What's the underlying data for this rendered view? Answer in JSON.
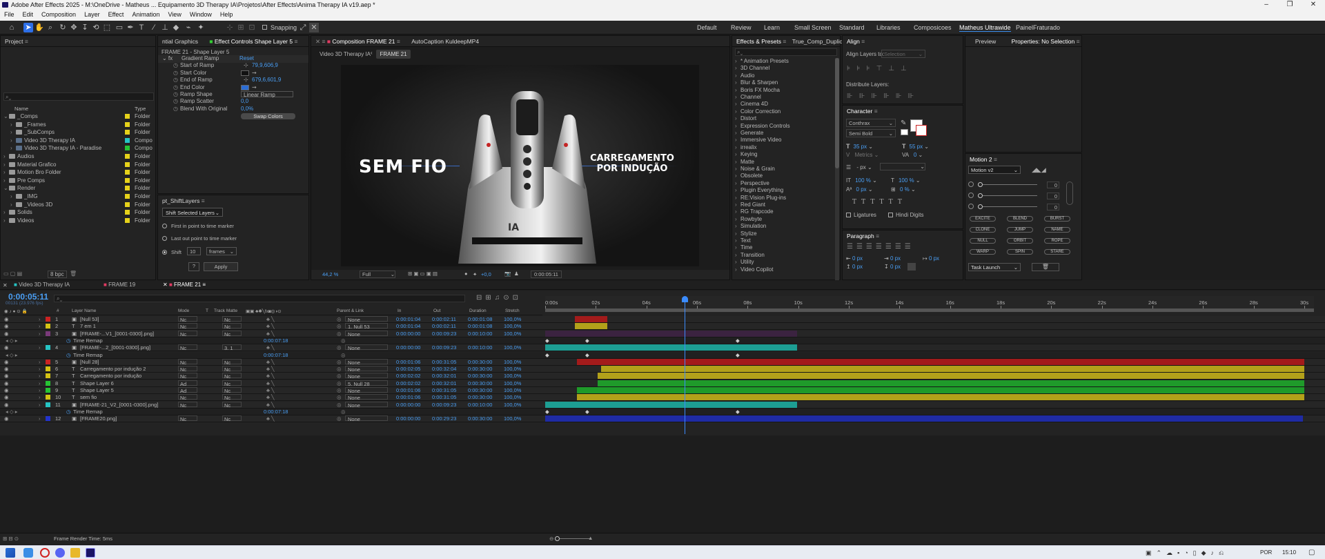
{
  "window": {
    "title": "Adobe After Effects 2025 - M:\\OneDrive - Matheus ... Equipamento 3D Therapy IA\\Projetos\\After Effects\\Anima Therapy IA v19.aep *"
  },
  "menu": [
    "File",
    "Edit",
    "Composition",
    "Layer",
    "Effect",
    "Animation",
    "View",
    "Window",
    "Help"
  ],
  "toolbar": {
    "snapping": "Snapping",
    "workspaces": [
      "Default",
      "Review",
      "Learn",
      "Small Screen",
      "Standard",
      "Libraries",
      "Composicoes",
      "Matheus Ultrawide",
      "PainelFraturado"
    ]
  },
  "project": {
    "title": "Project",
    "search": "",
    "col_name": "Name",
    "col_type": "Type",
    "bpc": "8 bpc",
    "items": [
      {
        "name": "_Comps",
        "type": "Folder",
        "color": "#e6d21a",
        "level": 0,
        "open": true
      },
      {
        "name": "_Frames",
        "type": "Folder",
        "color": "#e6d21a",
        "level": 1
      },
      {
        "name": "_SubComps",
        "type": "Folder",
        "color": "#e6d21a",
        "level": 1
      },
      {
        "name": "Video 3D Therapy IA",
        "type": "Compo",
        "color": "#26c4c4",
        "level": 1
      },
      {
        "name": "Video 3D Therapy IA - Paradise",
        "type": "Compo",
        "color": "#26c433",
        "level": 1
      },
      {
        "name": "Audios",
        "type": "Folder",
        "color": "#e6d21a",
        "level": 0
      },
      {
        "name": "Material Grafico",
        "type": "Folder",
        "color": "#e6d21a",
        "level": 0
      },
      {
        "name": "Motion Bro Folder",
        "type": "Folder",
        "color": "#e6d21a",
        "level": 0
      },
      {
        "name": "Pre Comps",
        "type": "Folder",
        "color": "#e6d21a",
        "level": 0
      },
      {
        "name": "Render",
        "type": "Folder",
        "color": "#e6d21a",
        "level": 0,
        "open": true
      },
      {
        "name": "_IMG",
        "type": "Folder",
        "color": "#e6d21a",
        "level": 1
      },
      {
        "name": "_Videos 3D",
        "type": "Folder",
        "color": "#e6d21a",
        "level": 1
      },
      {
        "name": "Solids",
        "type": "Folder",
        "color": "#e6d21a",
        "level": 0
      },
      {
        "name": "Videos",
        "type": "Folder",
        "color": "#e6d21a",
        "level": 0
      }
    ]
  },
  "effect_controls": {
    "tab_left": "ntial Graphics",
    "tab": "Effect Controls Shape Layer 5",
    "layer": "FRAME 21 - Shape Layer 5",
    "effect": "Gradient Ramp",
    "reset": "Reset",
    "props": [
      {
        "name": "Start of Ramp",
        "value": "79,9,606,9"
      },
      {
        "name": "Start Color",
        "value": ""
      },
      {
        "name": "End of Ramp",
        "value": "679,6,601,9"
      },
      {
        "name": "End Color",
        "value": ""
      },
      {
        "name": "Ramp Shape",
        "value": "Linear Ramp"
      },
      {
        "name": "Ramp Scatter",
        "value": "0,0"
      },
      {
        "name": "Blend With Original",
        "value": "0,0%"
      }
    ],
    "swap": "Swap Colors"
  },
  "shift": {
    "title": "pt_ShiftLayers",
    "mode": "Shift Selected Layers",
    "opt1": "First in point to time marker",
    "opt2": "Last out point to time marker",
    "opt3": "Shift",
    "amount": "10",
    "unit": "frames",
    "q": "?",
    "apply": "Apply"
  },
  "comp": {
    "tab": "Composition FRAME 21",
    "tab2": "AutoCaption KuldeepMP4",
    "crumb1": "Video 3D Therapy IA",
    "crumb2": "FRAME 21",
    "text_left": "SEM FIO",
    "text_right1": "CARREGAMENTO",
    "text_right2": "POR INDUÇÃO",
    "zoom": "44,2 %",
    "res": "Full",
    "exposure": "+0,0",
    "time": "0:00:05:11"
  },
  "effects": {
    "tab": "Effects & Presets",
    "tab2": "True_Comp_Duplica",
    "items": [
      "* Animation Presets",
      "3D Channel",
      "Audio",
      "Blur & Sharpen",
      "Boris FX Mocha",
      "Channel",
      "Cinema 4D",
      "Color Correction",
      "Distort",
      "Expression Controls",
      "Generate",
      "Immersive Video",
      "irrealix",
      "Keying",
      "Matte",
      "Noise & Grain",
      "Obsolete",
      "Perspective",
      "Plugin Everything",
      "RE:Vision Plug-ins",
      "Red Giant",
      "RG Trapcode",
      "Rowbyte",
      "Simulation",
      "Stylize",
      "Text",
      "Time",
      "Transition",
      "Utility",
      "Video Copilot"
    ]
  },
  "align": {
    "title": "Align",
    "align_to": "Align Layers to:",
    "selection": "Selection",
    "distribute": "Distribute Layers:"
  },
  "character": {
    "title": "Character",
    "font": "Conthrax",
    "style": "Semi Bold",
    "size": "35 px",
    "leading": "55 px",
    "tracking_label": "Metrics",
    "tracking": "0",
    "stroke": "- px",
    "vscale": "100 %",
    "hscale": "100 %",
    "baseline": "0 px",
    "tsume": "0 %",
    "ligatures": "Ligatures",
    "hindi": "Hindi Digits"
  },
  "paragraph": {
    "title": "Paragraph",
    "vals": [
      "0 px",
      "0 px",
      "0 px",
      "0 px",
      "0 px"
    ]
  },
  "preview": {
    "title": "Preview",
    "props": "Properties: No Selection"
  },
  "motion": {
    "title": "Motion 2",
    "preset": "Motion v2",
    "vals": [
      "0",
      "0",
      "0"
    ],
    "buttons": [
      "EXCITE",
      "BLEND",
      "BURST",
      "CLONE",
      "JUMP",
      "NAME",
      "NULL",
      "ORBIT",
      "ROPE",
      "WARP",
      "SPIN",
      "STARE"
    ],
    "launch": "Task Launch"
  },
  "timeline": {
    "tabs": [
      "Video 3D Therapy IA",
      "FRAME 19",
      "FRAME 21"
    ],
    "timecode": "0:00:05:11",
    "fps": "00131 (23.976 fps)",
    "cols": {
      "layer": "Layer Name",
      "mode": "Mode",
      "t": "T",
      "matte": "Track Matte",
      "parent": "Parent & Link",
      "in": "In",
      "out": "Out",
      "dur": "Duration",
      "stretch": "Stretch"
    },
    "ruler": [
      "0:00s",
      "02s",
      "04s",
      "06s",
      "08s",
      "10s",
      "12s",
      "14s",
      "16s",
      "18s",
      "20s",
      "22s",
      "24s",
      "26s",
      "28s",
      "30s"
    ],
    "layers": [
      {
        "num": "1",
        "name": "[Null 53]",
        "color": "#cc2222",
        "mode": "Nc",
        "matte": "Nc",
        "parent": "None",
        "in": "0:00:01:04",
        "out": "0:00:02:11",
        "dur": "0:00:01:08",
        "stretch": "100,0%",
        "bar_color": "#a31b1b",
        "start": 0.0,
        "end": 0.0
      },
      {
        "num": "2",
        "name": "7 em 1",
        "color": "#d4c214",
        "mode": "Nc",
        "matte": "Nc",
        "parent": "1. Null 53",
        "in": "0:00:01:04",
        "out": "0:00:02:11",
        "dur": "0:00:01:08",
        "stretch": "100,0%",
        "bar_color": "#b3a11a"
      },
      {
        "num": "3",
        "name": "[FRAME-...V1_[0001-0300].png]",
        "color": "#7a3a7a",
        "mode": "Nc",
        "matte": "Nc",
        "parent": "None",
        "in": "0:00:00:00",
        "out": "0:00:09:23",
        "dur": "0:00:10:00",
        "stretch": "100,0%",
        "bar_color": "#3b2340"
      },
      {
        "num": "",
        "name": "Time Remap",
        "sub": true,
        "val": "0:00:07:18"
      },
      {
        "num": "4",
        "name": "[FRAME-...2_[0001-0300].png]",
        "color": "#26c4c4",
        "mode": "Nc",
        "matte": "3. 1",
        "parent": "None",
        "in": "0:00:00:00",
        "out": "0:00:09:23",
        "dur": "0:00:10:00",
        "stretch": "100,0%",
        "bar_color": "#1d9e93"
      },
      {
        "num": "",
        "name": "Time Remap",
        "sub": true,
        "val": "0:00:07:18"
      },
      {
        "num": "5",
        "name": "[Null 28]",
        "color": "#cc2222",
        "mode": "Nc",
        "matte": "Nc",
        "parent": "None",
        "in": "0:00:01:06",
        "out": "0:00:31:05",
        "dur": "0:00:30:00",
        "stretch": "100,0%",
        "bar_color": "#a31b1b"
      },
      {
        "num": "6",
        "name": "Carregamento por indução 2",
        "color": "#d4c214",
        "mode": "Nc",
        "matte": "Nc",
        "parent": "None",
        "in": "0:00:02:05",
        "out": "0:00:32:04",
        "dur": "0:00:30:00",
        "stretch": "100,0%",
        "bar_color": "#b3a11a"
      },
      {
        "num": "7",
        "name": "Carregamento por indução",
        "color": "#d4c214",
        "mode": "Nc",
        "matte": "Nc",
        "parent": "None",
        "in": "0:00:02:02",
        "out": "0:00:32:01",
        "dur": "0:00:30:00",
        "stretch": "100,0%",
        "bar_color": "#b3a11a"
      },
      {
        "num": "8",
        "name": "Shape Layer 6",
        "color": "#26c433",
        "mode": "Ad",
        "matte": "Nc",
        "parent": "5. Null 28",
        "in": "0:00:02:02",
        "out": "0:00:32:01",
        "dur": "0:00:30:00",
        "stretch": "100,0%",
        "bar_color": "#1f9a2a"
      },
      {
        "num": "9",
        "name": "Shape Layer 5",
        "color": "#26c433",
        "mode": "Ad",
        "matte": "Nc",
        "parent": "None",
        "in": "0:00:01:06",
        "out": "0:00:31:05",
        "dur": "0:00:30:00",
        "stretch": "100,0%",
        "bar_color": "#1f9a2a"
      },
      {
        "num": "10",
        "name": "sem fio",
        "color": "#d4c214",
        "mode": "Nc",
        "matte": "Nc",
        "parent": "None",
        "in": "0:00:01:06",
        "out": "0:00:31:05",
        "dur": "0:00:30:00",
        "stretch": "100,0%",
        "bar_color": "#b3a11a"
      },
      {
        "num": "11",
        "name": "[FRAME-21_V2_[0001-0300].png]",
        "color": "#26c4c4",
        "mode": "Nc",
        "matte": "Nc",
        "parent": "None",
        "in": "0:00:00:00",
        "out": "0:00:09:23",
        "dur": "0:00:10:00",
        "stretch": "100,0%",
        "bar_color": "#1d9e93"
      },
      {
        "num": "",
        "name": "Time Remap",
        "sub": true,
        "val": "0:00:07:18"
      },
      {
        "num": "12",
        "name": "[FRAME20.png]",
        "color": "#2233cc",
        "mode": "Nc",
        "matte": "Nc",
        "parent": "None",
        "in": "0:00:00:00",
        "out": "0:00:29:23",
        "dur": "0:00:30:00",
        "stretch": "100,0%",
        "bar_color": "#1f2ba3"
      }
    ],
    "render_time": "Frame Render Time: 5ms"
  },
  "taskbar": {
    "lang": "POR",
    "clock": "15:10"
  }
}
